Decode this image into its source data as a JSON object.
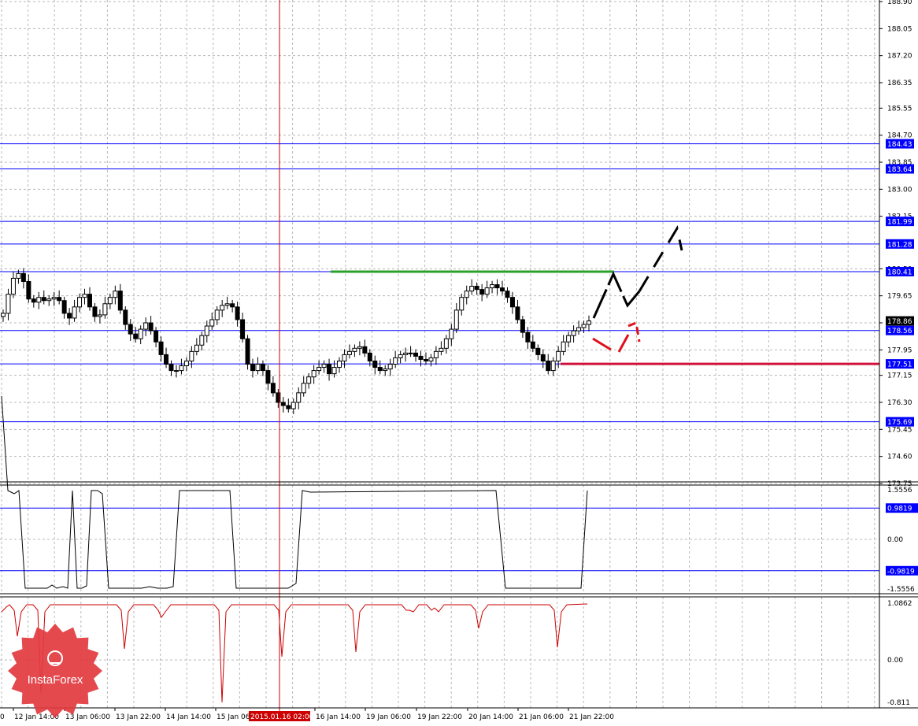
{
  "chart_data": {
    "type": "candlestick",
    "main": {
      "y_ticks": [
        "188.90",
        "188.05",
        "187.20",
        "186.35",
        "185.55",
        "184.70",
        "183.85",
        "183.00",
        "182.15",
        "180.50",
        "179.65",
        "178.80",
        "177.95",
        "177.15",
        "176.30",
        "175.45",
        "174.60",
        "173.75"
      ],
      "ylim": [
        173.75,
        188.9
      ],
      "horizontal_levels": [
        {
          "label": "184.43",
          "value": 184.43
        },
        {
          "label": "183.64",
          "value": 183.64
        },
        {
          "label": "181.99",
          "value": 181.99
        },
        {
          "label": "181.28",
          "value": 181.28
        },
        {
          "label": "180.41",
          "value": 180.41
        },
        {
          "label": "178.56",
          "value": 178.56
        },
        {
          "label": "177.51",
          "value": 177.51
        },
        {
          "label": "175.69",
          "value": 175.69
        }
      ],
      "current_price": {
        "label": "178.86",
        "value": 178.86
      },
      "green_resistance": {
        "value": 180.41,
        "from": "15 Jan 2015 ~16:00",
        "to": "22 Jan 2015 ~10:00"
      },
      "red_support": {
        "value": 177.51,
        "from": "21 Jan 2015 ~06:00",
        "to": "24 Jan 2015"
      },
      "close_series": [
        179.1,
        179.7,
        180.2,
        180.35,
        180.1,
        179.55,
        179.45,
        179.6,
        179.5,
        179.55,
        179.6,
        179.5,
        179.1,
        178.95,
        179.3,
        179.6,
        179.7,
        179.3,
        179.0,
        179.05,
        179.4,
        179.6,
        179.8,
        179.2,
        178.75,
        178.45,
        178.3,
        178.6,
        178.8,
        178.55,
        178.2,
        177.8,
        177.5,
        177.3,
        177.3,
        177.45,
        177.6,
        177.9,
        178.1,
        178.4,
        178.7,
        178.9,
        179.2,
        179.35,
        179.4,
        179.3,
        178.9,
        178.3,
        177.5,
        177.3,
        177.5,
        177.3,
        176.9,
        176.6,
        176.3,
        176.2,
        176.1,
        176.3,
        176.6,
        176.9,
        177.1,
        177.3,
        177.4,
        177.5,
        177.2,
        177.4,
        177.6,
        177.8,
        177.9,
        178.0,
        178.05,
        177.85,
        177.6,
        177.4,
        177.3,
        177.35,
        177.5,
        177.7,
        177.8,
        177.85,
        177.85,
        177.75,
        177.65,
        177.6,
        177.7,
        177.9,
        178.0,
        178.3,
        178.6,
        179.2,
        179.6,
        179.8,
        179.95,
        179.85,
        179.7,
        179.9,
        180.0,
        179.9,
        179.8,
        179.6,
        179.3,
        178.9,
        178.5,
        178.2,
        178.0,
        177.8,
        177.6,
        177.3,
        177.6,
        177.9,
        178.2,
        178.4,
        178.55,
        178.65,
        178.75,
        178.86
      ]
    },
    "forecast": {
      "black_path": [
        [
          "22 Jan 02:00",
          178.86
        ],
        [
          "22 Jan 10:00",
          180.41
        ],
        [
          "22 Jan 18:00",
          179.65
        ],
        [
          "23 Jan 00:00",
          179.9
        ],
        [
          "23 Jan 18:00",
          182.0
        ],
        [
          "23 Jan 22:00",
          181.28
        ]
      ],
      "red_path": [
        [
          "22 Jan 02:00",
          178.25
        ],
        [
          "22 Jan 12:00",
          177.8
        ],
        [
          "22 Jan 20:00",
          178.5
        ],
        [
          "23 Jan 02:00",
          178.8
        ],
        [
          "23 Jan 02:00",
          178.15
        ]
      ]
    },
    "indicator_1": {
      "y_ticks": [
        "1.5556",
        "0.9819",
        "0.00",
        "-0.9819",
        "-1.5556"
      ],
      "levels": [
        0.9819,
        -0.9819
      ],
      "ylim": [
        -1.5556,
        1.5556
      ]
    },
    "indicator_2": {
      "y_ticks": [
        "1.0862",
        "0.00",
        "-0.811"
      ],
      "ylim": [
        -0.811,
        1.0862
      ]
    },
    "x_ticks": [
      "12 Jan 14:00",
      "13 Jan 06:00",
      "13 Jan 22:00",
      "14 Jan 14:00",
      "15 Jan 06:00",
      "2015.01.16 02:00",
      "16 Jan 14:00",
      "19 Jan 06:00",
      "19 Jan 22:00",
      "20 Jan 14:00",
      "21 Jan 06:00",
      "21 Jan 22:00"
    ],
    "x_tick_first": "0",
    "cursor_label": "2015.01.16 02:00",
    "watermark": "InstaForex",
    "colors": {
      "level": "#0000ff",
      "candle": "#000000",
      "cursor": "#cc0000",
      "green_line": "#2ca02c",
      "red_line": "#d0103a",
      "ind2": "#cc0000",
      "forecast_black": "#000000",
      "forecast_red": "#e0101e",
      "watermark": "#e23a3f"
    }
  }
}
